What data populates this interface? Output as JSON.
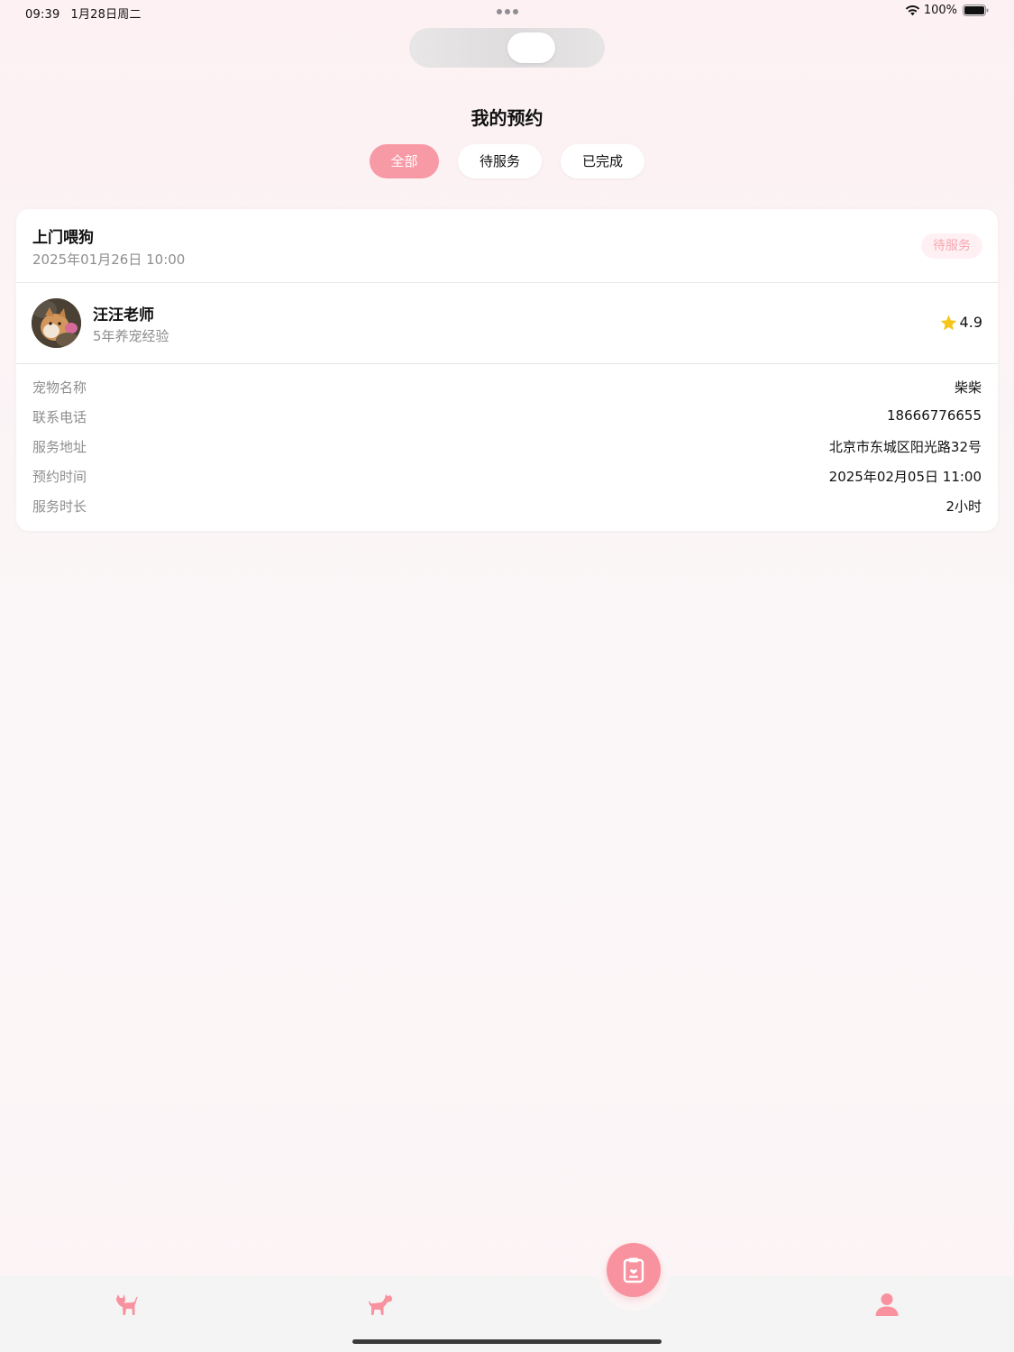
{
  "status_bar": {
    "time": "09:39",
    "date": "1月28日周二",
    "battery": "100%"
  },
  "page": {
    "title": "我的预约"
  },
  "filter_tabs": [
    {
      "label": "全部",
      "active": true
    },
    {
      "label": "待服务",
      "active": false
    },
    {
      "label": "已完成",
      "active": false
    }
  ],
  "booking": {
    "service": "上门喂狗",
    "created_time": "2025年01月26日 10:00",
    "status": "待服务",
    "sitter": {
      "name": "汪汪老师",
      "experience": "5年养宠经验",
      "rating": "4.9"
    },
    "details": [
      {
        "label": "宠物名称",
        "value": "柴柴"
      },
      {
        "label": "联系电话",
        "value": "18666776655"
      },
      {
        "label": "服务地址",
        "value": "北京市东城区阳光路32号"
      },
      {
        "label": "预约时间",
        "value": "2025年02月05日 11:00"
      },
      {
        "label": "服务时长",
        "value": "2小时"
      }
    ]
  },
  "tab_bar": {
    "items": [
      {
        "icon": "cat-icon"
      },
      {
        "icon": "dog-icon"
      },
      {
        "icon": "clipboard-icon",
        "active": true
      },
      {
        "icon": "profile-icon"
      }
    ]
  },
  "colors": {
    "accent": "#f89aa5",
    "badge_bg": "#fff1f3",
    "badge_text": "#f6a6b1",
    "star": "#f5c518",
    "secondary_text": "#8e8e8e"
  }
}
